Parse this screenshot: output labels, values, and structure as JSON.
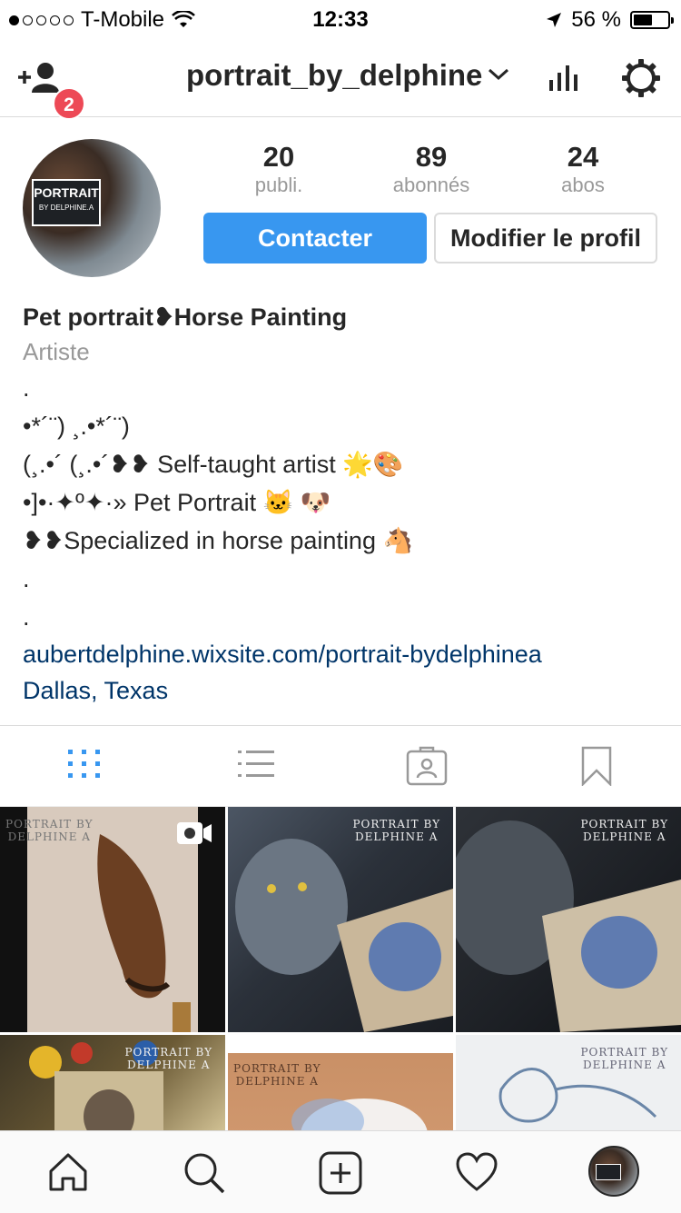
{
  "status_bar": {
    "carrier": "T-Mobile",
    "time": "12:33",
    "battery": "56 %",
    "battery_level": 0.56
  },
  "nav": {
    "username": "portrait_by_delphine",
    "notification_count": "2"
  },
  "profile": {
    "avatar_text_main": "PORTRAIT",
    "avatar_text_sub": "BY DELPHINE.A",
    "stats": [
      {
        "value": "20",
        "label": "publi."
      },
      {
        "value": "89",
        "label": "abonnés"
      },
      {
        "value": "24",
        "label": "abos"
      }
    ],
    "contact_button": "Contacter",
    "edit_button": "Modifier le profil"
  },
  "bio": {
    "name": "Pet portrait❥Horse Painting",
    "category": "Artiste",
    "lines": [
      ".",
      "•*´¨) ¸.•*´¨)",
      "(¸.•´ (¸.•´❥❥ Self-taught artist 🌟🎨",
      "•]•·✦º✦·» Pet Portrait 🐱 🐶",
      "❥❥Specialized in horse painting 🐴",
      ".",
      "."
    ],
    "website": "aubertdelphine.wixsite.com/portrait-bydelphinea",
    "location": "Dallas, Texas"
  },
  "grid": {
    "watermark_line1": "PORTRAIT BY",
    "watermark_line2": "DELPHINE A"
  },
  "colors": {
    "accent": "#3897f0",
    "badge": "#ed4956",
    "link": "#003569"
  }
}
